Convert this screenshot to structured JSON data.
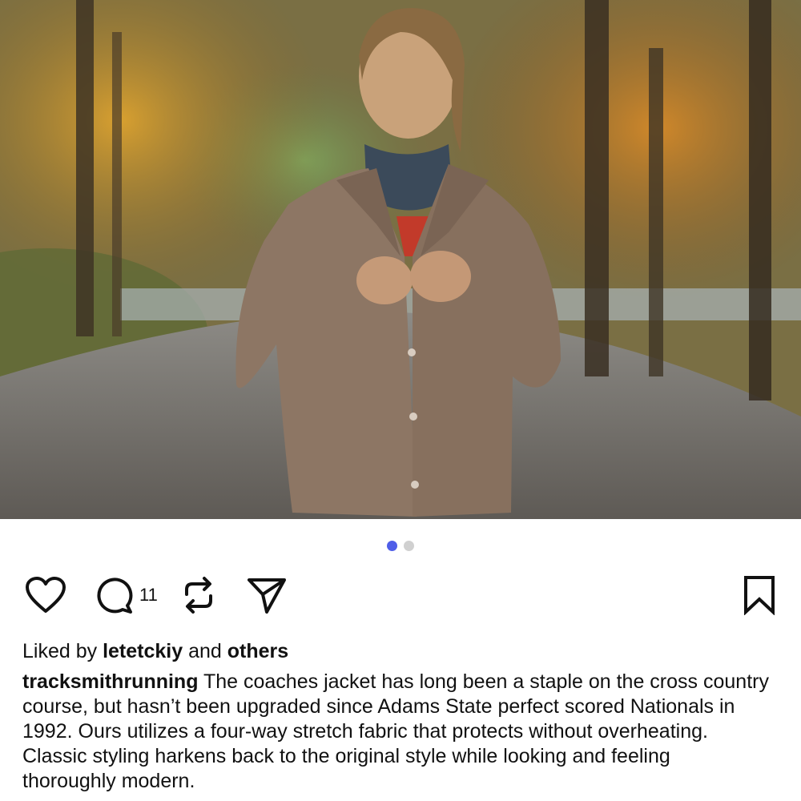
{
  "post": {
    "image_alt": "Runner in a tan coaches jacket on an autumn road",
    "carousel": {
      "count": 2,
      "active_index": 0,
      "active_color": "#4f5ee8",
      "inactive_color": "#d0d0d0"
    }
  },
  "actions": {
    "like_icon": "heart-icon",
    "comment_icon": "comment-icon",
    "comment_count": "11",
    "repost_icon": "repost-icon",
    "share_icon": "share-icon",
    "save_icon": "bookmark-icon"
  },
  "likes": {
    "prefix": "Liked by ",
    "user": "letetckiy",
    "middle": " and ",
    "others": "others"
  },
  "caption": {
    "username": "tracksmithrunning",
    "text": " The coaches jacket has long been a staple on the cross country course, but hasn’t been upgraded since Adams State perfect scored Nationals in 1992. Ours utilizes a four-way stretch fabric that protects without overheating. Classic styling harkens back to the original style while looking and feeling thoroughly modern."
  }
}
